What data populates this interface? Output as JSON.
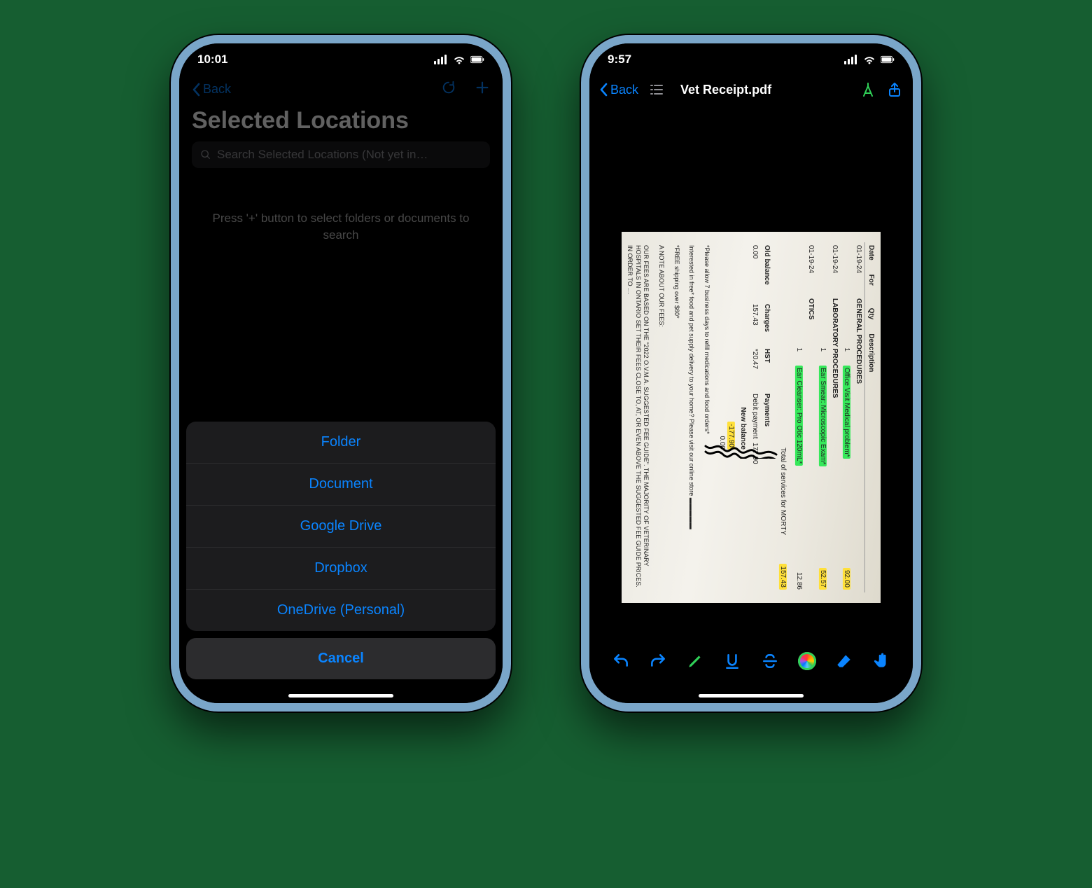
{
  "left": {
    "status_time": "10:01",
    "nav_back": "Back",
    "title": "Selected Locations",
    "search_placeholder": "Search Selected Locations  (Not yet in…",
    "empty_hint": "Press '+' button to select folders or documents to search",
    "sheet": [
      "Folder",
      "Document",
      "Google Drive",
      "Dropbox",
      "OneDrive (Personal)"
    ],
    "cancel": "Cancel"
  },
  "right": {
    "status_time": "9:57",
    "nav_back": "Back",
    "doc_title": "Vet Receipt.pdf",
    "receipt": {
      "headers": {
        "date": "Date",
        "for": "For",
        "qty": "Qty",
        "desc": "Description"
      },
      "lines": [
        {
          "date": "01-19-24",
          "section": "GENERAL PROCEDURES"
        },
        {
          "date": "",
          "qty": "1",
          "desc": "Office Visit Medical problem*",
          "amt": "92.00",
          "hl": "green",
          "amthl": "yellow"
        },
        {
          "date": "01-19-24",
          "section": "LABORATORY PROCEDURES"
        },
        {
          "date": "",
          "qty": "1",
          "desc": "Ear Smear: Microscopic Exam*",
          "amt": "52.57",
          "hl": "green",
          "amthl": "yellow"
        },
        {
          "date": "01-19-24",
          "section": "OTICS"
        },
        {
          "date": "",
          "qty": "1",
          "desc": "Ear Cleanser: Pro Otic 120mL*",
          "amt": "12.86",
          "hl": "green",
          "amthl": "none"
        }
      ],
      "total_label": "Total of services for MORTY",
      "total_amt": "157.43",
      "summary": {
        "cols": [
          "Old balance",
          "Charges",
          "HST",
          "Payments",
          "New balance"
        ],
        "vals": [
          "0.00",
          "157.43",
          "*20.47",
          "177.90",
          "0.00"
        ],
        "paytype": "Debit payment",
        "neg": "-177.90"
      },
      "notes": [
        "*Please allow 7 business days to refill medications and food orders*",
        "Interested in free* food and pet supply delivery to your home? Please visit our online store ▬▬▬▬▬",
        "*FREE shipping over $60*",
        "A NOTE ABOUT OUR FEES:",
        "OUR FEES ARE BASED ON THE \"2022 O.V.M.A. SUGGESTED FEE GUIDE\". THE MAJORITY OF VETERINARY HOSPITALS IN ONTARIO SET THEIR FEES CLOSE TO, AT, OR EVEN ABOVE THE SUGGESTED FEE GUIDE PRICES. IN ORDER TO …"
      ]
    }
  }
}
